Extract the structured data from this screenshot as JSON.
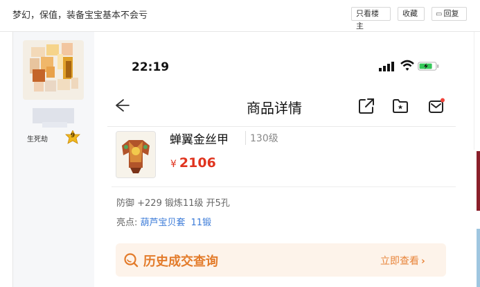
{
  "forum": {
    "title": "梦幻，保值，装备宝宝基本不会亏",
    "buttons": {
      "only_op": "只看楼主",
      "favorite": "收藏",
      "reply": "回复"
    }
  },
  "user": {
    "rank_label": "生死劫",
    "rank_level": "9"
  },
  "phone": {
    "time": "22:19",
    "nav_title": "商品详情",
    "item": {
      "name": "蝉翼金丝甲",
      "level": "130级",
      "currency": "¥",
      "price": "2106"
    },
    "attrs": {
      "line1": "防御 +229 锻炼11级 开5孔",
      "highlight_prefix": "亮点:",
      "highlight1": "葫芦宝贝套",
      "highlight2": "11锻"
    },
    "history": {
      "label": "历史成交查询",
      "link": "立即查看"
    }
  },
  "colors": {
    "price": "#e0341f",
    "accent_orange": "#e37b2a",
    "link_blue": "#3b7bd8",
    "history_bg": "#fdf3ea"
  },
  "icons": [
    "reply-icon",
    "back-icon",
    "share-icon",
    "folder-icon",
    "message-icon",
    "search-icon",
    "chevron-right-icon",
    "signal-icon",
    "wifi-icon",
    "battery-icon"
  ]
}
